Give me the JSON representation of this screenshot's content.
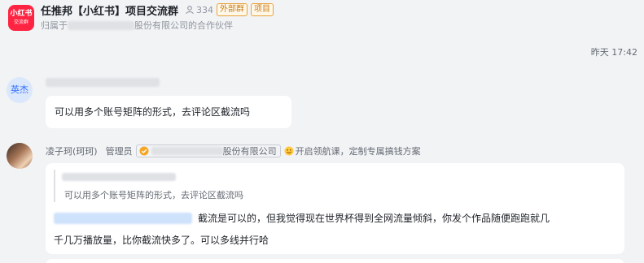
{
  "header": {
    "group_avatar_line1": "小红书",
    "group_avatar_line2": "交流群",
    "title": "任推邦【小红书】项目交流群",
    "member_count": "334",
    "tag_external": "外部群",
    "tag_project": "项目",
    "subtitle_prefix": "归属于",
    "subtitle_suffix": "股份有限公司的合作伙伴"
  },
  "timestamp": "昨天 17:42",
  "messages": [
    {
      "avatar_text": "英杰",
      "text": "可以用多个账号矩阵的形式，去评论区截流吗"
    },
    {
      "sender": "凌子珂(珂珂)",
      "role": "管理员",
      "company_suffix": "股份有限公司",
      "status": "开启领航课，定制专属搞钱方案",
      "quote_text": "可以用多个账号矩阵的形式，去评论区截流吗",
      "body_line1": "截流是可以的，但我觉得现在世界杯得到全网流量倾斜，你发个作品随便跑跑就几",
      "body_line2": "千几万播放量，比你截流快多了。可以多线并行哈"
    }
  ],
  "colors": {
    "accent": "#3370ff",
    "brand_red": "#ff2442",
    "tag_orange": "#e8a33d"
  }
}
